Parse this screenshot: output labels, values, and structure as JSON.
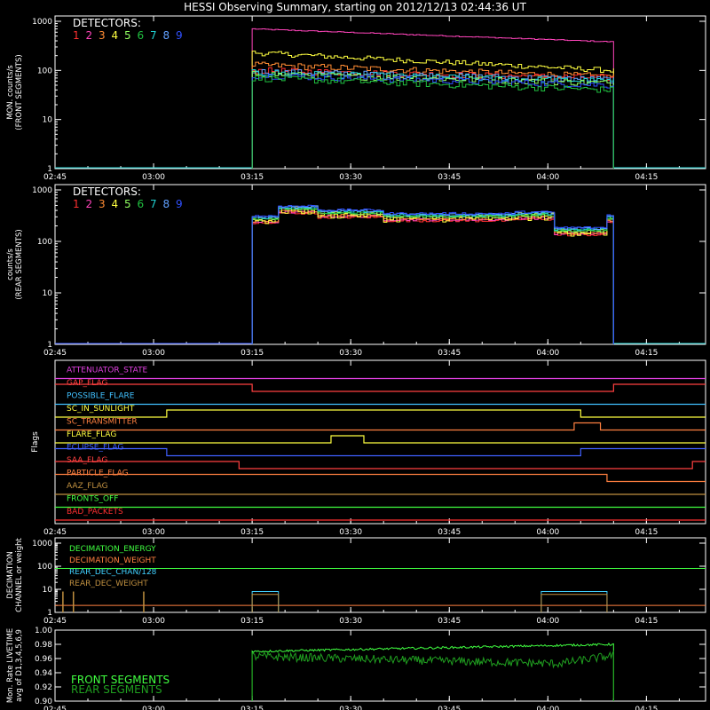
{
  "title": "HESSI Observing Summary, starting on 2012/12/13 02:44:36 UT",
  "time_ticks": [
    "02:45",
    "03:00",
    "03:15",
    "03:30",
    "03:45",
    "04:00",
    "04:15"
  ],
  "time_tick_minutes": [
    0,
    15,
    30,
    45,
    60,
    75,
    90
  ],
  "time_range_minutes": [
    0,
    99
  ],
  "detector_colors": [
    "#ff3030",
    "#ff44bb",
    "#ff8c33",
    "#ffff40",
    "#90ff60",
    "#20c040",
    "#20d0d0",
    "#60a0ff",
    "#3050ff"
  ],
  "chart_data": [
    {
      "type": "line",
      "title": "DETECTORS:",
      "ylabel": "MON. counts/s\n(FRONT SEGMENTS)",
      "yscale": "log",
      "ylim": [
        1,
        1000
      ],
      "ytick_labels": [
        "1",
        "10",
        "100",
        "1000"
      ],
      "legend": [
        "1",
        "2",
        "3",
        "4",
        "5",
        "6",
        "7",
        "8",
        "9"
      ],
      "data_interval_minutes": [
        30,
        85
      ],
      "series": [
        {
          "values_start": 700,
          "values_end": 380,
          "color_index": 1
        },
        {
          "values_start": 230,
          "values_end": 100,
          "color_index": 3
        },
        {
          "values_start": 130,
          "values_end": 75,
          "color_index": 2
        },
        {
          "values_start": 100,
          "values_end": 70,
          "color_index": 0
        },
        {
          "values_start": 95,
          "values_end": 65,
          "color_index": 7
        },
        {
          "values_start": 90,
          "values_end": 60,
          "color_index": 6
        },
        {
          "values_start": 85,
          "values_end": 55,
          "color_index": 4
        },
        {
          "values_start": 80,
          "values_end": 50,
          "color_index": 8
        },
        {
          "values_start": 70,
          "values_end": 40,
          "color_index": 5
        }
      ]
    },
    {
      "type": "line",
      "title": "DETECTORS:",
      "ylabel": "counts/s\n(REAR SEGMENTS)",
      "yscale": "log",
      "ylim": [
        1,
        1000
      ],
      "ytick_labels": [
        "1",
        "10",
        "100",
        "1000"
      ],
      "legend": [
        "1",
        "2",
        "3",
        "4",
        "5",
        "6",
        "7",
        "8",
        "9"
      ],
      "data_interval_minutes": [
        30,
        85
      ],
      "levels": [
        {
          "t": [
            30,
            34
          ],
          "v": 270
        },
        {
          "t": [
            34,
            40
          ],
          "v": 420
        },
        {
          "t": [
            40,
            50
          ],
          "v": 350
        },
        {
          "t": [
            50,
            70
          ],
          "v": 300
        },
        {
          "t": [
            70,
            76
          ],
          "v": 320
        },
        {
          "t": [
            76,
            84
          ],
          "v": 160
        },
        {
          "t": [
            84,
            85
          ],
          "v": 280
        }
      ]
    },
    {
      "type": "flags",
      "ylabel": "Flags",
      "flags": [
        {
          "name": "ATTENUATOR_STATE",
          "color": "#e040e0",
          "segments": [
            [
              0,
              99,
              0
            ]
          ]
        },
        {
          "name": "GAP_FLAG",
          "color": "#ff4040",
          "segments": [
            [
              0,
              30,
              1
            ],
            [
              30,
              85,
              0
            ],
            [
              85,
              99,
              1
            ]
          ]
        },
        {
          "name": "POSSIBLE_FLARE",
          "color": "#40c0ff",
          "segments": [
            [
              0,
              99,
              0
            ]
          ]
        },
        {
          "name": "SC_IN_SUNLIGHT",
          "color": "#ffff40",
          "segments": [
            [
              0,
              17,
              0
            ],
            [
              17,
              80,
              1
            ],
            [
              80,
              99,
              0
            ]
          ]
        },
        {
          "name": "SC_TRANSMITTER",
          "color": "#ff8040",
          "segments": [
            [
              0,
              79,
              0
            ],
            [
              79,
              83,
              1
            ],
            [
              83,
              99,
              0
            ]
          ]
        },
        {
          "name": "FLARE_FLAG",
          "color": "#ffff40",
          "segments": [
            [
              0,
              42,
              0
            ],
            [
              42,
              47,
              1
            ],
            [
              47,
              99,
              0
            ]
          ]
        },
        {
          "name": "ECLIPSE_FLAG",
          "color": "#4060ff",
          "segments": [
            [
              0,
              17,
              1
            ],
            [
              17,
              80,
              0
            ],
            [
              80,
              99,
              1
            ]
          ]
        },
        {
          "name": "SAA_FLAG",
          "color": "#ff4040",
          "segments": [
            [
              0,
              28,
              1
            ],
            [
              28,
              97,
              0
            ],
            [
              97,
              99,
              1
            ]
          ]
        },
        {
          "name": "PARTICLE_FLAG",
          "color": "#ff8040",
          "segments": [
            [
              0,
              84,
              1
            ],
            [
              84,
              99,
              0
            ]
          ]
        },
        {
          "name": "AAZ_FLAG",
          "color": "#c09040",
          "segments": [
            [
              0,
              99,
              0
            ]
          ]
        },
        {
          "name": "FRONTS_OFF",
          "color": "#40ff40",
          "segments": [
            [
              0,
              99,
              0
            ]
          ]
        },
        {
          "name": "BAD_PACKETS",
          "color": "#ff3030",
          "segments": [
            [
              0,
              99,
              0
            ]
          ]
        }
      ]
    },
    {
      "type": "line",
      "ylabel": "DECIMATION\nCHANNEL or weight",
      "yscale": "log",
      "ylim": [
        1,
        1000
      ],
      "ytick_labels": [
        "1",
        "10",
        "100",
        "1000"
      ],
      "legend": [
        "DECIMATION_ENERGY",
        "DECIMATION_WEIGHT",
        "REAR_DEC_CHAN/128",
        "REAR_DEC_WEIGHT"
      ],
      "legend_colors": [
        "#40ff40",
        "#ff8040",
        "#40d0ff",
        "#c09040"
      ]
    },
    {
      "type": "line",
      "ylabel": "Mon. Rate LIVETIME\navg of D1,3,4,5,6,9",
      "ylim": [
        0.9,
        1.0
      ],
      "ytick_labels": [
        "0.90",
        "0.92",
        "0.94",
        "0.96",
        "0.98",
        "1.00"
      ],
      "legend": [
        "FRONT SEGMENTS",
        "REAR SEGMENTS"
      ],
      "legend_colors": [
        "#40ff40",
        "#20a020"
      ],
      "series": [
        {
          "name": "FRONT SEGMENTS",
          "values_start": 0.97,
          "values_end": 0.98
        },
        {
          "name": "REAR SEGMENTS",
          "values_start": 0.96,
          "values_end": 0.955
        }
      ]
    }
  ]
}
